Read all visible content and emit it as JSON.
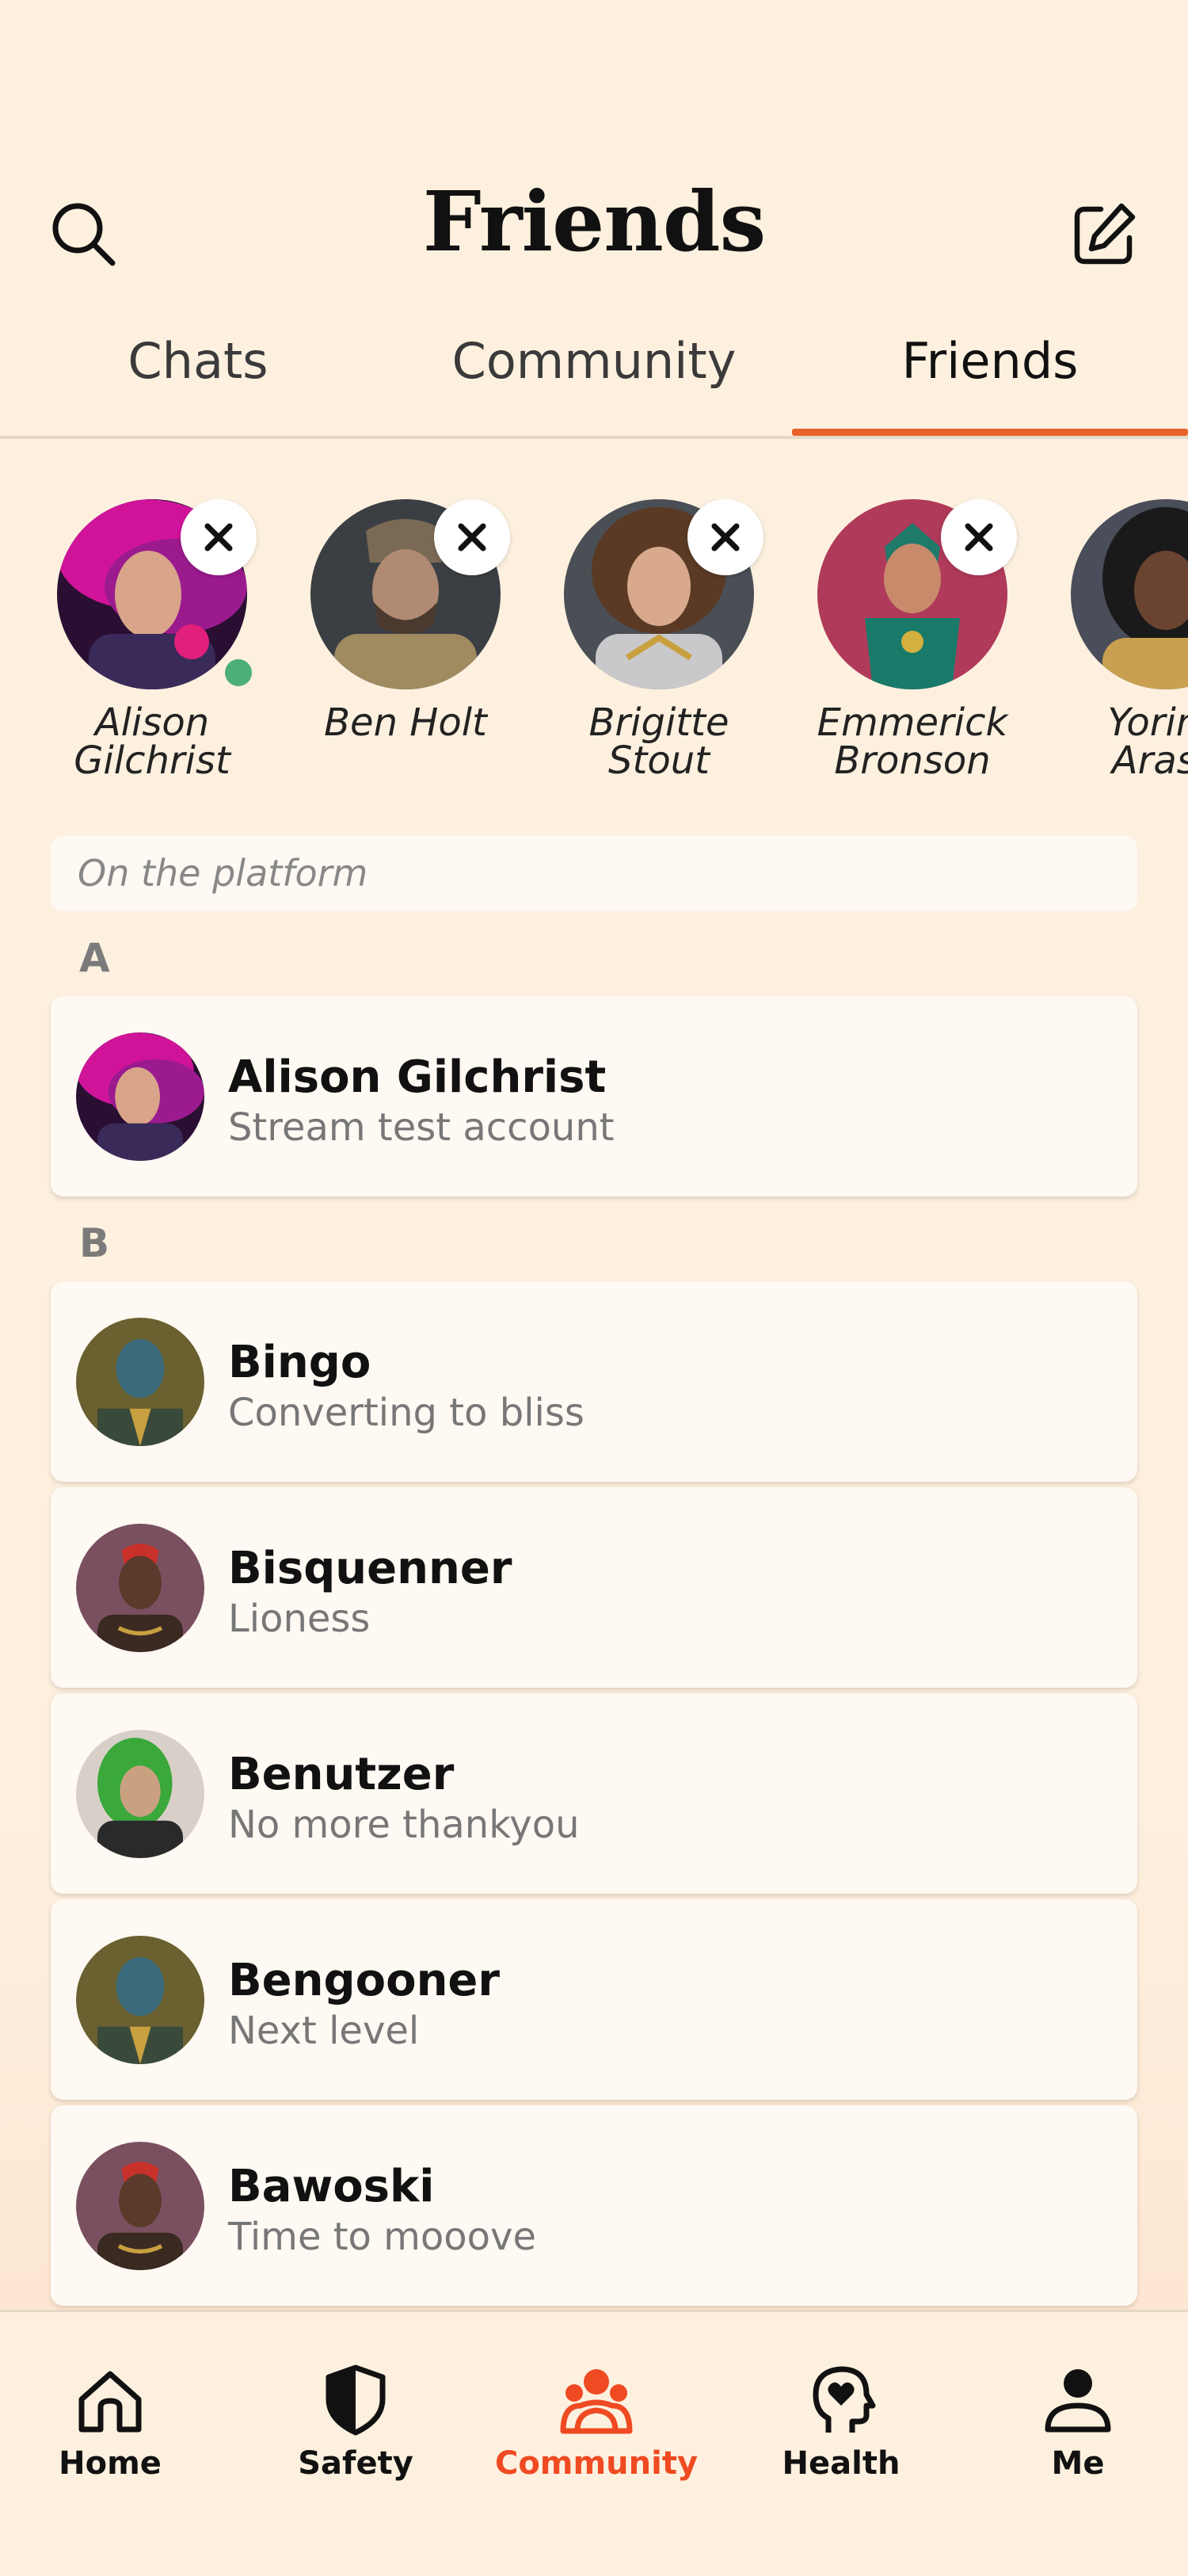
{
  "header": {
    "title": "Friends"
  },
  "tabs": [
    {
      "label": "Chats"
    },
    {
      "label": "Community"
    },
    {
      "label": "Friends"
    }
  ],
  "stories": [
    {
      "name": "Alison\nGilchrist",
      "online": true
    },
    {
      "name": "Ben Holt"
    },
    {
      "name": "Brigitte\nStout"
    },
    {
      "name": "Emmerick\nBronson"
    },
    {
      "name": "Yorind\nArasa"
    }
  ],
  "filter": {
    "label": "On the platform"
  },
  "sections": [
    {
      "letter": "A",
      "items": [
        {
          "name": "Alison Gilchrist",
          "subtitle": "Stream test account"
        }
      ]
    },
    {
      "letter": "B",
      "items": [
        {
          "name": "Bingo",
          "subtitle": "Converting to bliss"
        },
        {
          "name": "Bisquenner",
          "subtitle": "Lioness"
        },
        {
          "name": "Benutzer",
          "subtitle": "No more thankyou"
        },
        {
          "name": "Bengooner",
          "subtitle": "Next level"
        },
        {
          "name": "Bawoski",
          "subtitle": "Time to mooove"
        }
      ]
    }
  ],
  "tabbar": [
    {
      "label": "Home",
      "icon": "home-icon"
    },
    {
      "label": "Safety",
      "icon": "shield-icon"
    },
    {
      "label": "Community",
      "icon": "community-icon",
      "active": true
    },
    {
      "label": "Health",
      "icon": "head-heart-icon"
    },
    {
      "label": "Me",
      "icon": "person-icon"
    }
  ],
  "colors": {
    "accent": "#e9622a",
    "online": "#4caf78",
    "active_tab": "#ef4a22",
    "background": "#fdf0df"
  }
}
